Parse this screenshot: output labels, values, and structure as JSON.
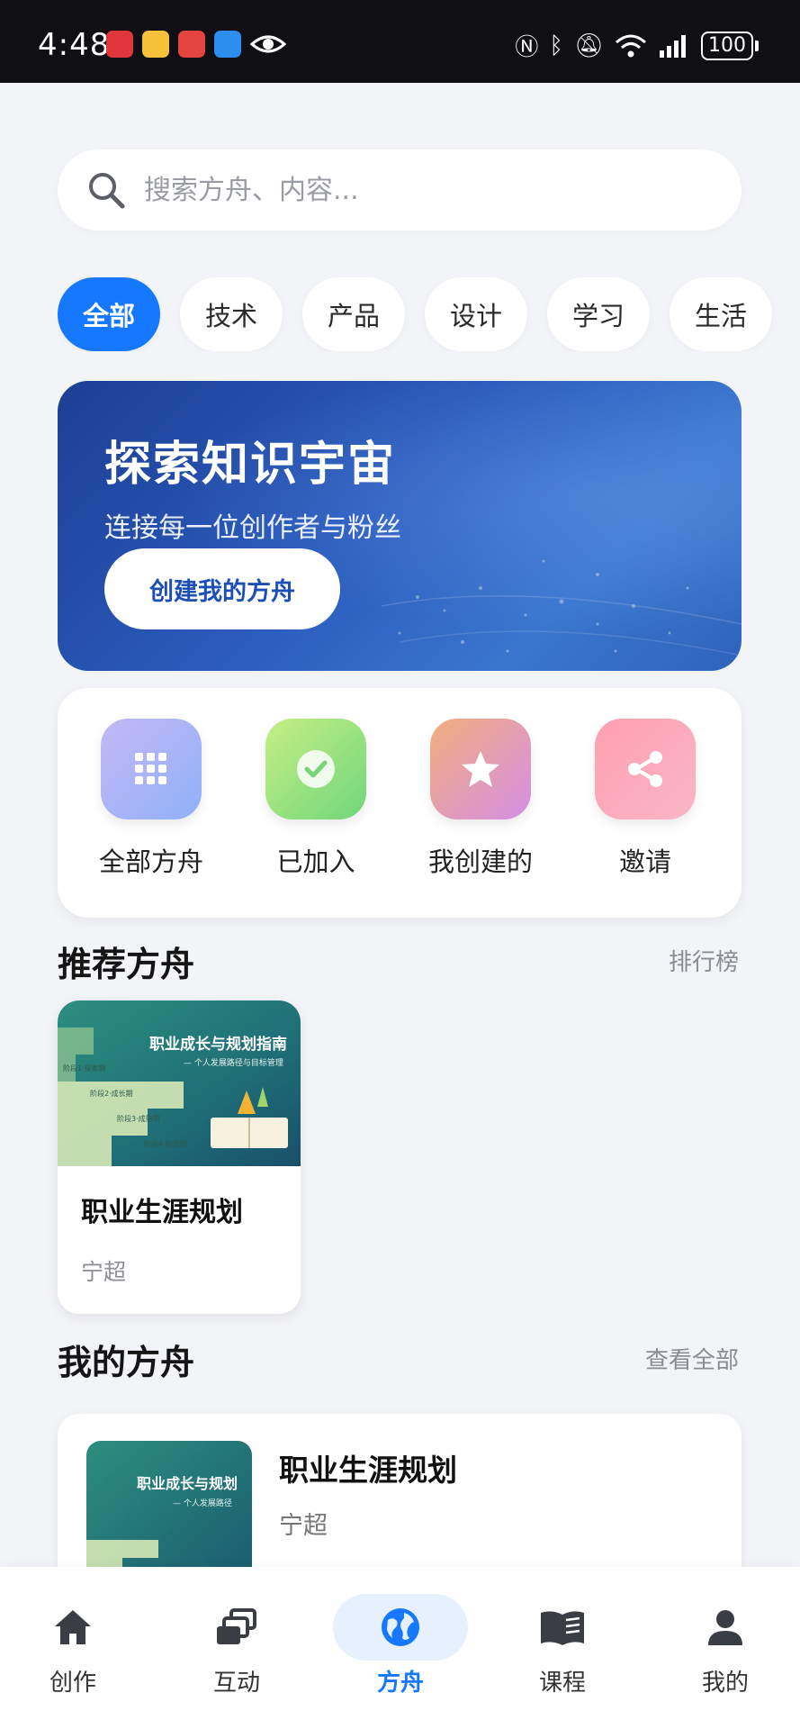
{
  "status_bar": {
    "time": "4:48",
    "battery": "100"
  },
  "search": {
    "placeholder": "搜索方舟、内容..."
  },
  "chips": [
    {
      "label": "全部",
      "active": true
    },
    {
      "label": "技术"
    },
    {
      "label": "产品"
    },
    {
      "label": "设计"
    },
    {
      "label": "学习"
    },
    {
      "label": "生活"
    }
  ],
  "banner": {
    "title": "探索知识宇宙",
    "subtitle": "连接每一位创作者与粉丝",
    "button": "创建我的方舟"
  },
  "quick_actions": [
    {
      "label": "全部方舟",
      "icon": "grid-icon",
      "color": "#a8b6f7"
    },
    {
      "label": "已加入",
      "icon": "check-icon",
      "color": "#93e07a"
    },
    {
      "label": "我创建的",
      "icon": "star-icon",
      "color": "#e89ad6"
    },
    {
      "label": "邀请",
      "icon": "share-icon",
      "color": "#f9a5b8"
    }
  ],
  "recommend": {
    "title": "推荐方舟",
    "link": "排行榜",
    "cards": [
      {
        "thumb_title": "职业成长与规划指南",
        "thumb_sub": "— 个人发展路径与目标管理",
        "steps": [
          "阶段1·探索期",
          "阶段2·成长期",
          "阶段3·成熟期",
          "阶段4·稳定期"
        ],
        "title": "职业生涯规划",
        "author": "宁超"
      }
    ]
  },
  "my_arks": {
    "title": "我的方舟",
    "link": "查看全部",
    "items": [
      {
        "thumb_title": "职业成长与规划",
        "thumb_sub": "— 个人发展路径",
        "title": "职业生涯规划",
        "author": "宁超"
      }
    ]
  },
  "bottom_nav": [
    {
      "label": "创作",
      "icon": "home-icon"
    },
    {
      "label": "互动",
      "icon": "stack-icon"
    },
    {
      "label": "方舟",
      "icon": "globe-icon",
      "active": true
    },
    {
      "label": "课程",
      "icon": "book-icon"
    },
    {
      "label": "我的",
      "icon": "person-icon"
    }
  ],
  "colors": {
    "accent": "#1677ff",
    "background": "#f3f4f8"
  }
}
